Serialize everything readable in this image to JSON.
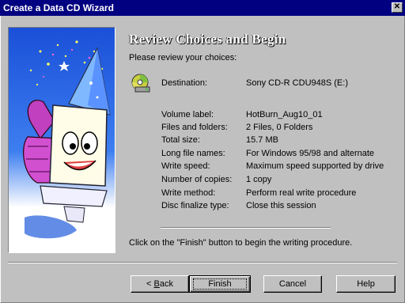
{
  "window": {
    "title": "Create a Data CD Wizard",
    "close_glyph": "✕"
  },
  "page": {
    "title": "Review Choices and Begin",
    "subtitle": "Please review your choices:"
  },
  "destination": {
    "label": "Destination:",
    "value": "Sony CD-R CDU948S (E:)"
  },
  "details": [
    {
      "label": "Volume label:",
      "value": "HotBurn_Aug10_01"
    },
    {
      "label": "Files and folders:",
      "value": "2 Files, 0 Folders"
    },
    {
      "label": "Total size:",
      "value": "15.7 MB"
    },
    {
      "label": "Long file names:",
      "value": "For Windows 95/98 and alternate"
    },
    {
      "label": "Write speed:",
      "value": "Maximum speed supported by drive"
    },
    {
      "label": "Number of copies:",
      "value": "1 copy"
    },
    {
      "label": "Write method:",
      "value": "Perform real write procedure"
    },
    {
      "label": "Disc finalize type:",
      "value": "Close this session"
    }
  ],
  "instruction": "Click on the \"Finish\" button to begin the writing procedure.",
  "buttons": {
    "back_prefix": "< ",
    "back_mnemonic": "B",
    "back_rest": "ack",
    "finish": "Finish",
    "cancel": "Cancel",
    "help": "Help"
  },
  "colors": {
    "titlebar": "#000080",
    "dialog_face": "#c0c0c0",
    "art_background": "#1a50d8"
  }
}
